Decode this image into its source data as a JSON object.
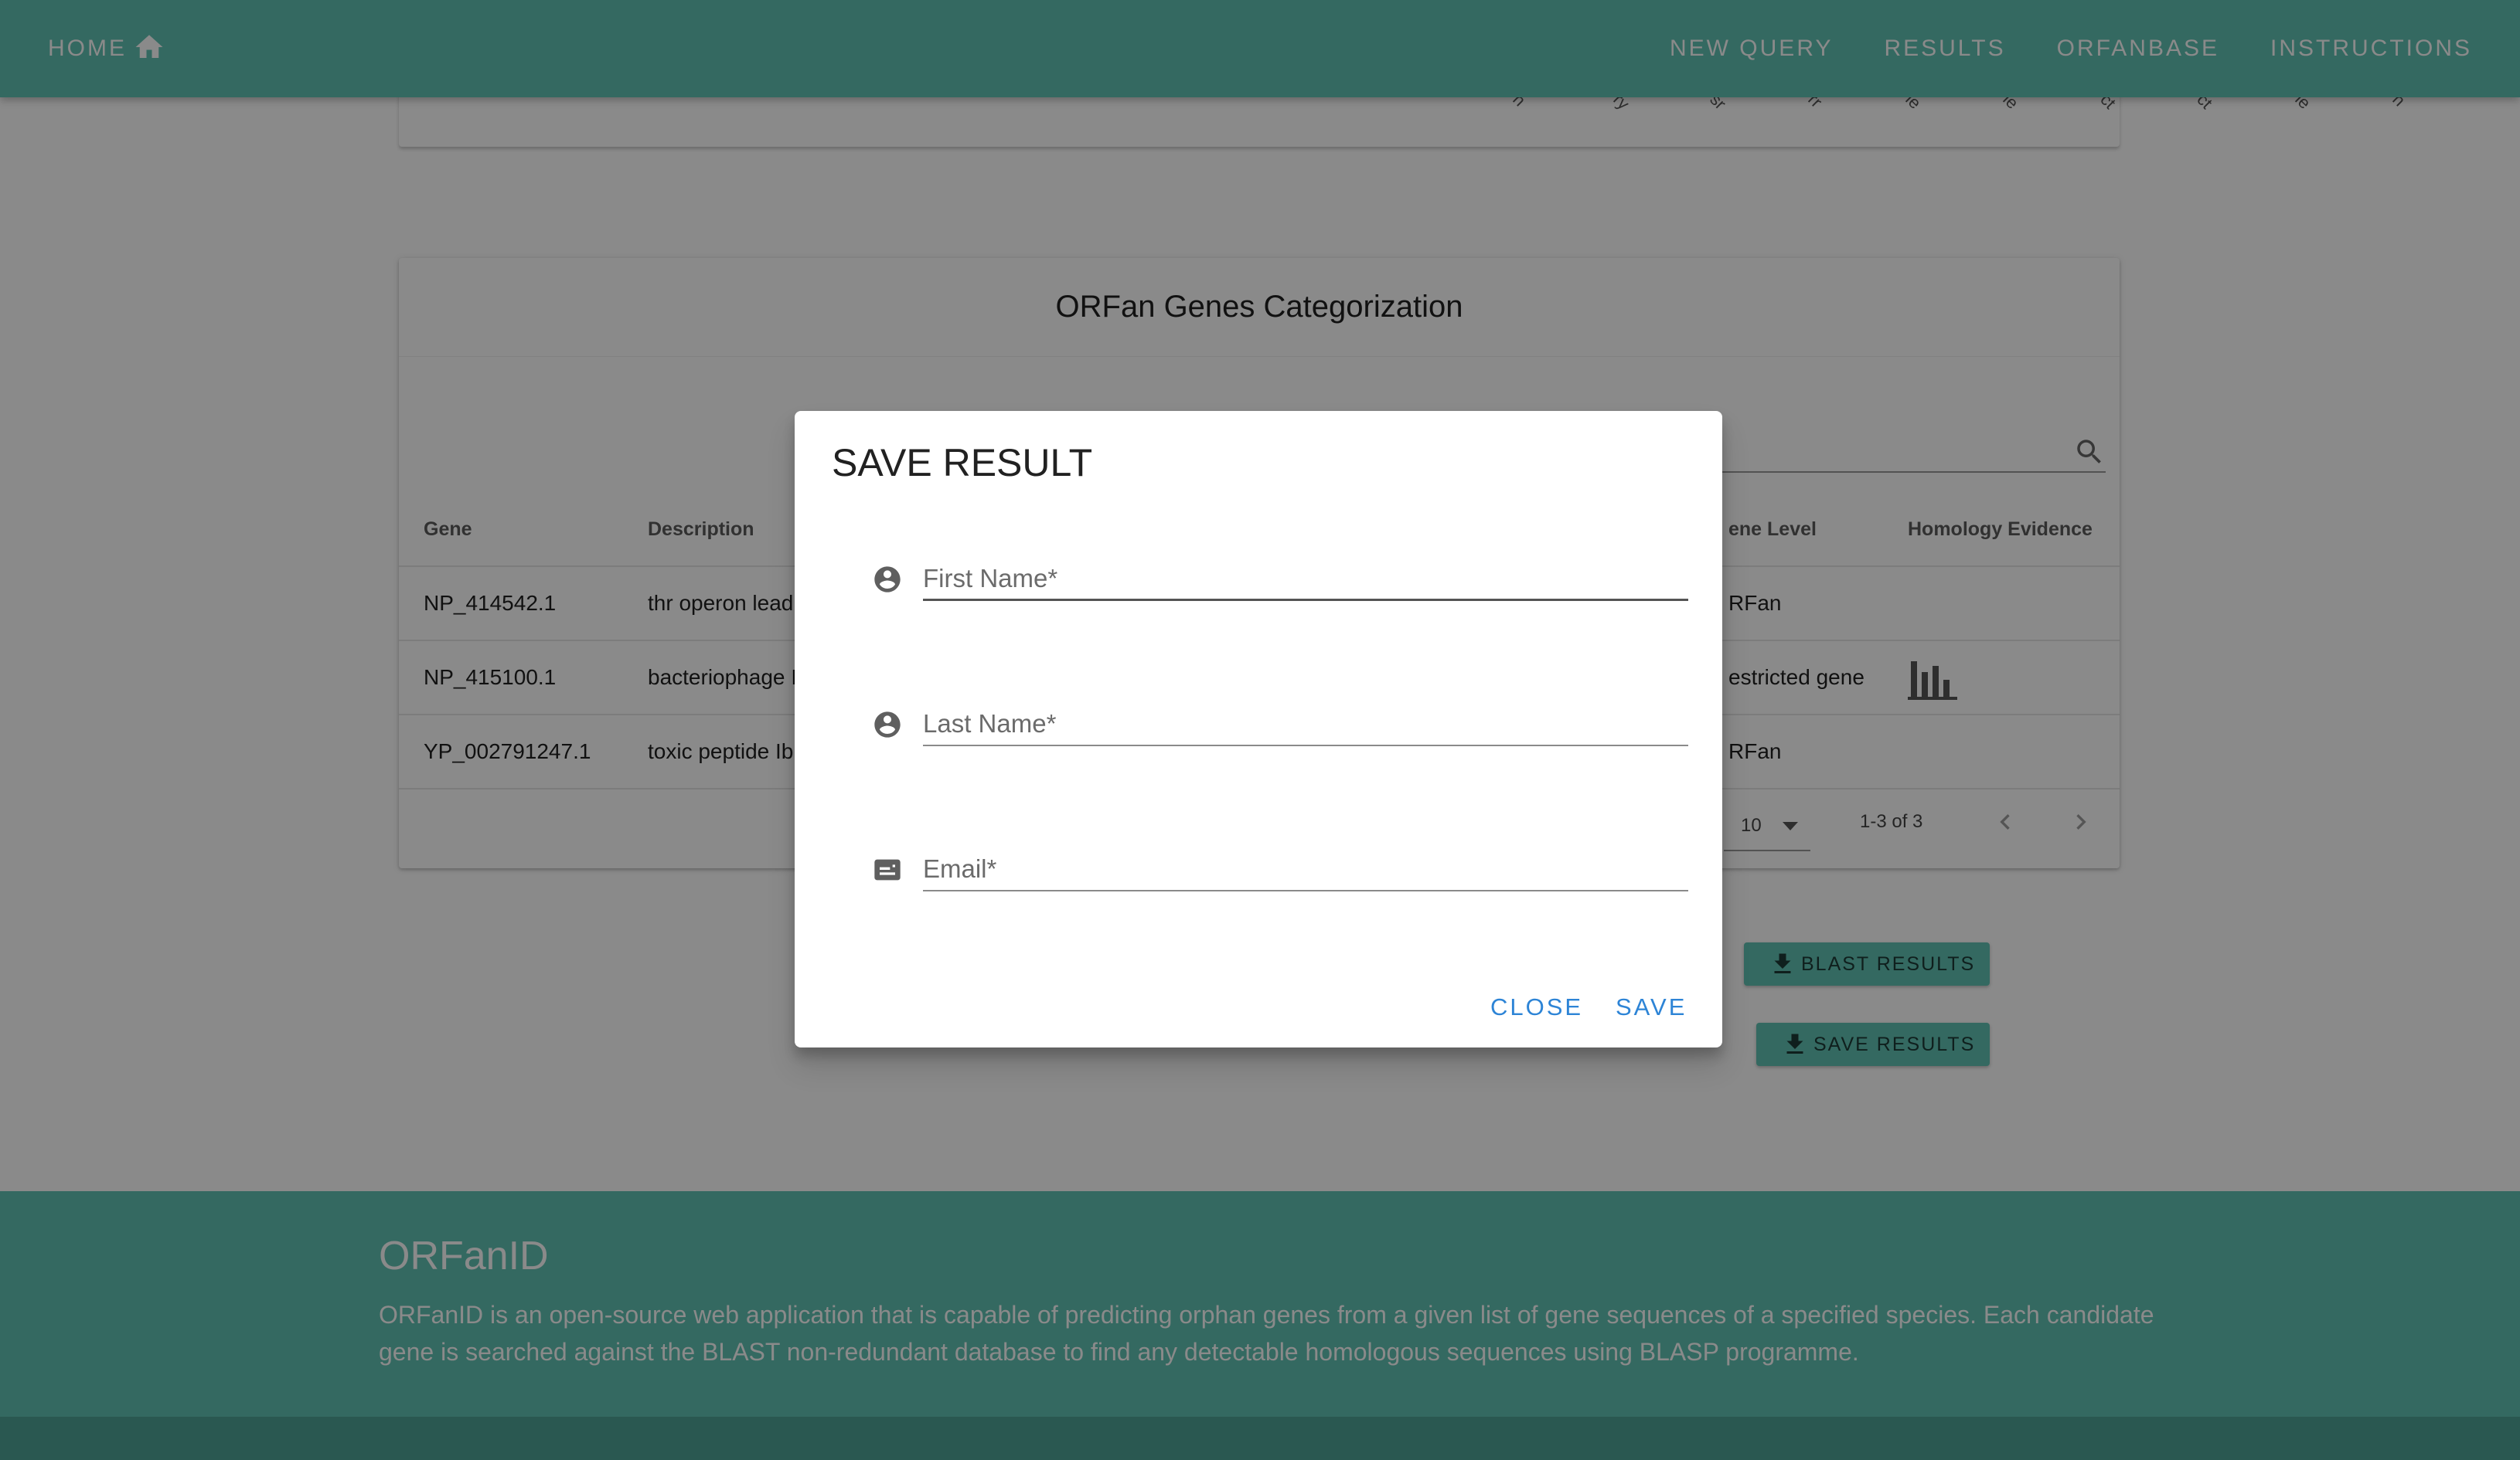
{
  "appbar": {
    "home_label": "HOME",
    "nav": [
      "NEW QUERY",
      "RESULTS",
      "ORFANBASE",
      "INSTRUCTIONS"
    ]
  },
  "rotated_ticks": [
    "n",
    "ry",
    "sr",
    "rr",
    "le",
    "le",
    "ct",
    "ct",
    "le",
    "n"
  ],
  "categorization": {
    "title": "ORFan Genes Categorization",
    "columns": {
      "gene": "Gene",
      "description": "Description",
      "level": "ene Level",
      "evidence": "Homology Evidence"
    },
    "rows": [
      {
        "gene": "NP_414542.1",
        "description": "thr operon lead",
        "level": "RFan",
        "evidence": false
      },
      {
        "gene": "NP_415100.1",
        "description": "bacteriophage I",
        "level": "estricted gene",
        "evidence": true
      },
      {
        "gene": "YP_002791247.1",
        "description": "toxic peptide Ib:",
        "level": "RFan",
        "evidence": false
      }
    ],
    "rows_per_page": "10",
    "range": "1-3 of 3"
  },
  "actions": {
    "blast": "BLAST RESULTS",
    "save": "SAVE RESULTS"
  },
  "footer": {
    "title": "ORFanID",
    "description": "ORFanID is an open-source web application that is capable of predicting orphan genes from a given list of gene sequences of a specified species. Each candidate gene is searched against the BLAST non-redundant database to find any detectable homologous sequences using BLASP programme."
  },
  "dialog": {
    "title": "SAVE RESULT",
    "first_name_placeholder": "First Name*",
    "last_name_placeholder": "Last Name*",
    "email_placeholder": "Email*",
    "close_label": "CLOSE",
    "save_label": "SAVE"
  },
  "colors": {
    "primary": "#61c2b3",
    "link": "#2d84d6"
  }
}
